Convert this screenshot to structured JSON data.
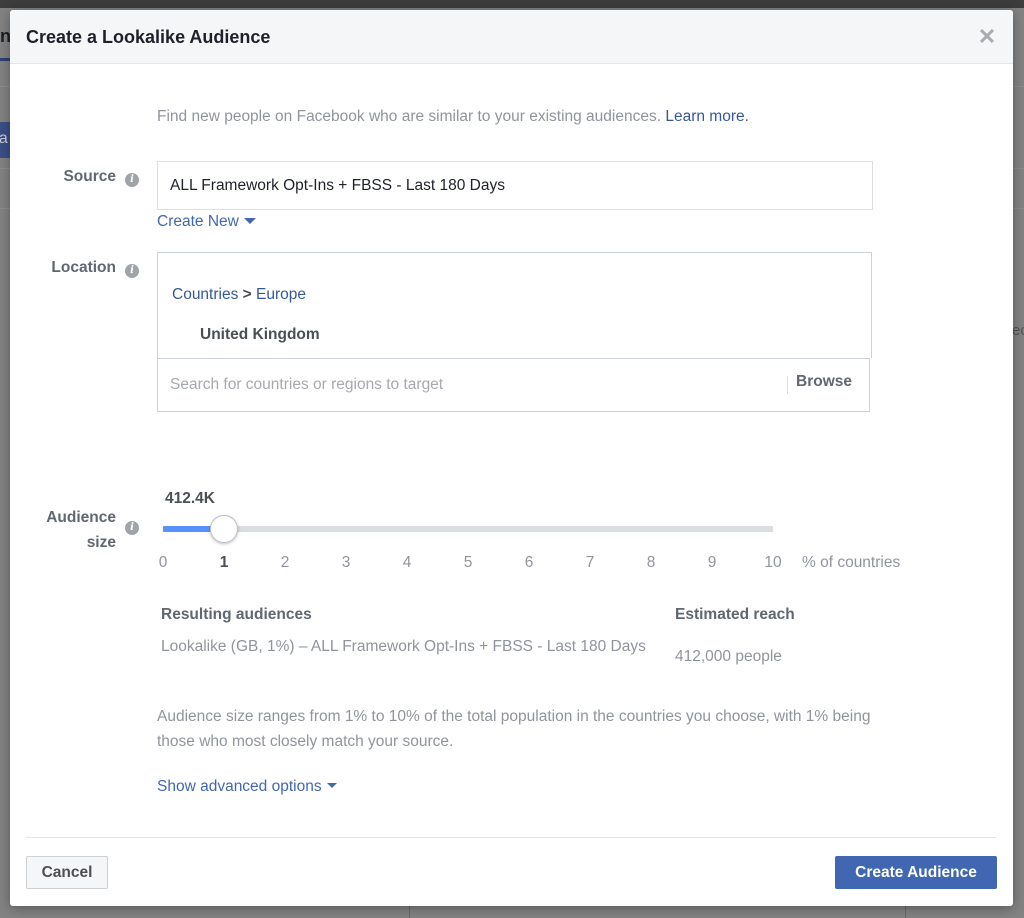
{
  "background": {
    "left_partial_text": "n",
    "left_partial_button": "ea",
    "right_partial_text": "ec"
  },
  "dialog": {
    "title": "Create a Lookalike Audience",
    "close_icon": "close-icon",
    "intro": "Find new people on Facebook who are similar to your existing audiences.",
    "learn_more": "Learn more."
  },
  "source": {
    "label": "Source",
    "info_icon": "info-icon",
    "value": "ALL Framework Opt-Ins + FBSS - Last 180 Days",
    "create_new": "Create New"
  },
  "location": {
    "label": "Location",
    "info_icon": "info-icon",
    "breadcrumb": {
      "root": "Countries",
      "separator": ">",
      "region": "Europe"
    },
    "selected": [
      "United Kingdom"
    ],
    "search_placeholder": "Search for countries or regions to target",
    "search_value": "",
    "browse": "Browse"
  },
  "audience_size": {
    "label_line1": "Audience",
    "label_line2": "size",
    "info_icon": "info-icon",
    "value_label": "412.4K",
    "slider": {
      "min": 0,
      "max": 10,
      "value": 1
    },
    "ticks": [
      "0",
      "1",
      "2",
      "3",
      "4",
      "5",
      "6",
      "7",
      "8",
      "9",
      "10"
    ],
    "active_tick": "1",
    "unit": "% of countries",
    "accent_color": "#5890ff"
  },
  "results": {
    "resulting_header": "Resulting audiences",
    "resulting_text": "Lookalike (GB, 1%) – ALL Framework Opt-Ins + FBSS - Last 180 Days",
    "reach_header": "Estimated reach",
    "reach_text": "412,000 people"
  },
  "helper_text": "Audience size ranges from 1% to 10% of the total population in the countries you choose, with 1% being those who most closely match your source.",
  "advanced_options": "Show advanced options",
  "footer": {
    "cancel": "Cancel",
    "create": "Create Audience",
    "primary_color": "#4267b2"
  }
}
